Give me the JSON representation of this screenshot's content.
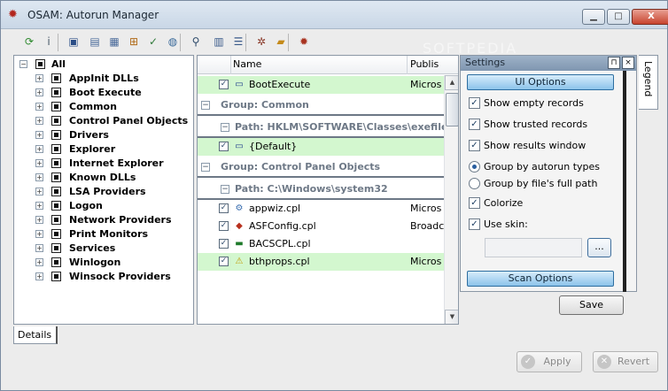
{
  "window": {
    "title": "OSAM: Autorun Manager",
    "min": "▁",
    "max": "□",
    "close": "X"
  },
  "toolbar": {
    "buttons": [
      {
        "icon": "refresh-icon",
        "glyph": "⟳",
        "color": "#2f8a2f"
      },
      {
        "icon": "info-icon",
        "glyph": "i",
        "color": "#4a5a6a"
      },
      {
        "icon": "save-icon",
        "glyph": "▣",
        "color": "#2a4d86"
      },
      {
        "icon": "doc-list-icon",
        "glyph": "▤",
        "color": "#4a6a9a"
      },
      {
        "icon": "doc-export-icon",
        "glyph": "▦",
        "color": "#4a6a9a"
      },
      {
        "icon": "hierarchy-icon",
        "glyph": "⊞",
        "color": "#b06a18"
      },
      {
        "icon": "doc-check-icon",
        "glyph": "✓",
        "color": "#2f7a3a"
      },
      {
        "icon": "doc-globe-icon",
        "glyph": "◍",
        "color": "#3a6a9a"
      },
      {
        "icon": "search-icon",
        "glyph": "⚲",
        "color": "#2d4a6a"
      },
      {
        "icon": "report-icon",
        "glyph": "▥",
        "color": "#3a5a8a"
      },
      {
        "icon": "list-icon",
        "glyph": "☰",
        "color": "#3a5a8a"
      },
      {
        "icon": "tools-icon",
        "glyph": "✲",
        "color": "#8a3a2a"
      },
      {
        "icon": "folder-icon",
        "glyph": "▰",
        "color": "#c48a1a"
      },
      {
        "icon": "settings-gear-icon",
        "glyph": "✹",
        "color": "#a8321f"
      }
    ]
  },
  "tree": {
    "items": [
      "All",
      "AppInit DLLs",
      "Boot Execute",
      "Common",
      "Control Panel Objects",
      "Drivers",
      "Explorer",
      "Internet Explorer",
      "Known DLLs",
      "LSA Providers",
      "Logon",
      "Network Providers",
      "Print Monitors",
      "Services",
      "Winlogon",
      "Winsock Providers"
    ]
  },
  "details_tab": "Details",
  "list": {
    "columns": {
      "name": "Name",
      "publisher": "Publis"
    },
    "rows": [
      {
        "type": "item",
        "bg": "green",
        "name": "BootExecute",
        "publisher": "Micros",
        "icon": "window-icon"
      },
      {
        "type": "group",
        "text": "Group: Common"
      },
      {
        "type": "path",
        "text": "Path: HKLM\\SOFTWARE\\Classes\\exefile\\s"
      },
      {
        "type": "item",
        "bg": "green",
        "name": "{Default}",
        "publisher": "",
        "icon": "window-icon"
      },
      {
        "type": "group",
        "text": "Group: Control Panel Objects"
      },
      {
        "type": "path",
        "text": "Path: C:\\Windows\\system32"
      },
      {
        "type": "item",
        "bg": "white",
        "name": "appwiz.cpl",
        "publisher": "Micros",
        "icon": "cpl-gear-icon"
      },
      {
        "type": "item",
        "bg": "white",
        "name": "ASFConfig.cpl",
        "publisher": "Broadc",
        "icon": "network-card-icon"
      },
      {
        "type": "item",
        "bg": "white",
        "name": "BACSCPL.cpl",
        "publisher": "",
        "icon": "board-icon"
      },
      {
        "type": "item",
        "bg": "green",
        "name": "bthprops.cpl",
        "publisher": "Micros",
        "icon": "warning-icon"
      }
    ]
  },
  "settings": {
    "title": "Settings",
    "pin": "⊓",
    "close": "×",
    "ui_options": "UI Options",
    "scan_options": "Scan Options",
    "options": [
      {
        "kind": "check",
        "checked": true,
        "label": "Show empty records"
      },
      {
        "kind": "check",
        "checked": true,
        "label": "Show trusted records"
      },
      {
        "kind": "check",
        "checked": true,
        "label": "Show results window"
      },
      {
        "kind": "radio",
        "checked": true,
        "label": "Group by autorun types"
      },
      {
        "kind": "radio",
        "checked": false,
        "label": "Group by file's full path"
      },
      {
        "kind": "check",
        "checked": true,
        "label": "Colorize"
      },
      {
        "kind": "check",
        "checked": true,
        "label": "Use skin:"
      }
    ],
    "browse_label": "...",
    "skin_value": ""
  },
  "legend": "Legend",
  "buttons": {
    "save": "Save",
    "apply": "Apply",
    "revert": "Revert"
  },
  "watermark": "SOFTPEDIA"
}
